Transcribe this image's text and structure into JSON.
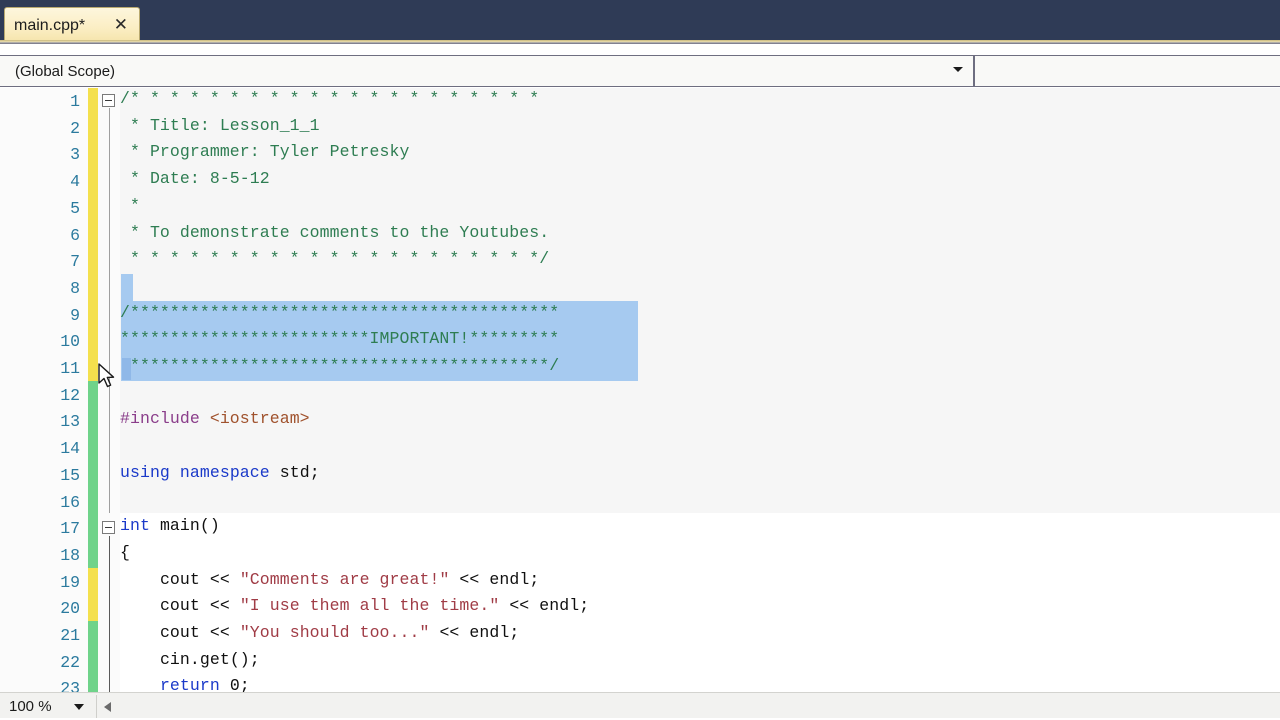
{
  "window": {
    "tab": {
      "label": "main.cpp*",
      "close_icon": "close-icon"
    }
  },
  "navbar": {
    "scope_value": "(Global Scope)",
    "scope_arrow_icon": "chevron-down-icon",
    "member_value": ""
  },
  "editor": {
    "first_line": 1,
    "line_numbers": [
      "1",
      "2",
      "3",
      "4",
      "5",
      "6",
      "7",
      "8",
      "9",
      "10",
      "11",
      "12",
      "13",
      "14",
      "15",
      "16",
      "17",
      "18",
      "19",
      "20",
      "21",
      "22",
      "23"
    ],
    "fold_markers": [
      {
        "line": 1,
        "icon": "collapse-minus-icon"
      },
      {
        "line": 17,
        "icon": "collapse-minus-icon"
      }
    ],
    "change_bar": [
      {
        "from_line": 1,
        "to_line": 11,
        "color": "#f4e04d",
        "state": "unsaved"
      },
      {
        "from_line": 12,
        "to_line": 18,
        "color": "#6fd38a",
        "state": "saved"
      },
      {
        "from_line": 19,
        "to_line": 20,
        "color": "#f4e04d",
        "state": "unsaved"
      },
      {
        "from_line": 21,
        "to_line": 23,
        "color": "#6fd38a",
        "state": "saved"
      }
    ],
    "selection_color": "#a6caf0",
    "selected_lines": [
      8,
      9,
      10,
      11
    ],
    "lines": [
      {
        "n": 1,
        "text": "/* * * * * * * * * * * * * * * * * * * * *",
        "kind": "comment"
      },
      {
        "n": 2,
        "text": " * Title: Lesson_1_1",
        "kind": "comment"
      },
      {
        "n": 3,
        "text": " * Programmer: Tyler Petresky",
        "kind": "comment"
      },
      {
        "n": 4,
        "text": " * Date: 8-5-12",
        "kind": "comment"
      },
      {
        "n": 5,
        "text": " *",
        "kind": "comment"
      },
      {
        "n": 6,
        "text": " * To demonstrate comments to the Youtubes.",
        "kind": "comment"
      },
      {
        "n": 7,
        "text": " * * * * * * * * * * * * * * * * * * * * */",
        "kind": "comment"
      },
      {
        "n": 8,
        "text": "",
        "kind": "blank"
      },
      {
        "n": 9,
        "text": "/*******************************************",
        "kind": "comment"
      },
      {
        "n": 10,
        "text": "*************************IMPORTANT!*********",
        "kind": "comment"
      },
      {
        "n": 11,
        "text": "*******************************************/",
        "kind": "comment"
      },
      {
        "n": 12,
        "text": "",
        "kind": "blank"
      },
      {
        "n": 13,
        "text": "#include <iostream>",
        "kind": "preprocessor"
      },
      {
        "n": 14,
        "text": "",
        "kind": "blank"
      },
      {
        "n": 15,
        "text": "using namespace std;",
        "kind": "code"
      },
      {
        "n": 16,
        "text": "",
        "kind": "blank"
      },
      {
        "n": 17,
        "text": "int main()",
        "kind": "code"
      },
      {
        "n": 18,
        "text": "{",
        "kind": "code"
      },
      {
        "n": 19,
        "text": "    cout << \"Comments are great!\" << endl;",
        "kind": "code"
      },
      {
        "n": 20,
        "text": "    cout << \"I use them all the time.\" << endl;",
        "kind": "code"
      },
      {
        "n": 21,
        "text": "    cout << \"You should too...\" << endl;",
        "kind": "code"
      },
      {
        "n": 22,
        "text": "    cin.get();",
        "kind": "code"
      },
      {
        "n": 23,
        "text": "    return 0;",
        "kind": "code"
      }
    ]
  },
  "statusbar": {
    "zoom_level": "100 %",
    "zoom_arrow_icon": "chevron-down-icon",
    "hscroll_left_icon": "scroll-left-arrow-icon"
  },
  "colors": {
    "tabstrip_bg": "#2f3b56",
    "tab_bg": "#fbeec4",
    "comment_green": "#2e7d52",
    "keyword_blue": "#1a39c9",
    "string_red": "#a03c46",
    "preprocessor_purple": "#8a3d8a",
    "include_brown": "#a0522d",
    "linenumber_blue": "#2b7a9e",
    "selection_blue": "#a6caf0",
    "changebar_unsaved": "#f4e04d",
    "changebar_saved": "#6fd38a"
  }
}
